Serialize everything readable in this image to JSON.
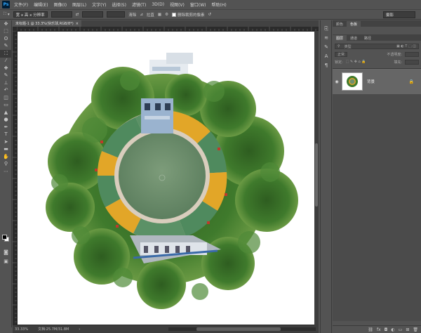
{
  "app": {
    "logo": "Ps"
  },
  "menu": [
    "文件(F)",
    "编辑(E)",
    "图像(I)",
    "图层(L)",
    "文字(Y)",
    "选择(S)",
    "滤镜(T)",
    "3D(D)",
    "视图(V)",
    "窗口(W)",
    "帮助(H)"
  ],
  "options": {
    "ratio": "宽 x 高 x 分辨率",
    "straighten": "拉直",
    "overlay": "清除",
    "delete_cropped_label": "删除裁剪的像素",
    "workspace": "摄影"
  },
  "document": {
    "tab_title": "未标题-1 @ 33.3%(快乐球,RGB/8*)",
    "close": "×"
  },
  "status": {
    "zoom": "33.33%",
    "doc_size": "文档:25.7M/31.8M"
  },
  "panels": {
    "top_tabs": [
      "颜色",
      "色板"
    ],
    "layers_tabs": [
      "图层",
      "通道",
      "路径"
    ],
    "kind_filter": "类型",
    "blend_mode": "正常",
    "opacity_label": "不透明度:",
    "lock_label": "锁定:",
    "fill_label": "填充:"
  },
  "layers": [
    {
      "name": "背景",
      "visible": true,
      "locked": true
    }
  ],
  "colors": {
    "ui_bg": "#535353",
    "canvas_bg": "#282828",
    "grass": "#6e8f6e",
    "track_green": "#4f8a5e",
    "track_yellow": "#e2a628",
    "trees": "#3f7a2c"
  }
}
